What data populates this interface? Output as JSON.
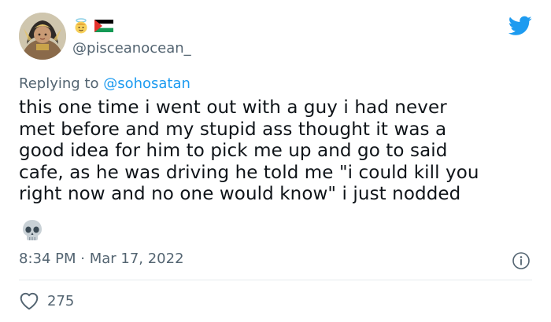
{
  "tweet": {
    "handle": "@pisceanocean_",
    "display_name_emojis": [
      "angel-emoji",
      "palestine-flag"
    ],
    "replying_prefix": "Replying to ",
    "replying_to": "@sohosatan",
    "text": "this one time i went out with a guy i had never\nmet before and my stupid ass thought it was a\ngood idea for him to pick me up and go to said\ncafe, as he was driving he told me \"i could kill you\nright now and no one would know\" i just nodded",
    "trailing_emoji": "skull-emoji",
    "timestamp": "8:34 PM · Mar 17, 2022",
    "like_count": "275"
  },
  "colors": {
    "twitter_blue": "#1d9bf0",
    "secondary_text": "#536471",
    "primary_text": "#0f1419",
    "divider": "#e6ebee"
  },
  "icons": {
    "brand": "twitter-bird-icon",
    "info": "info-icon",
    "like": "heart-icon"
  }
}
